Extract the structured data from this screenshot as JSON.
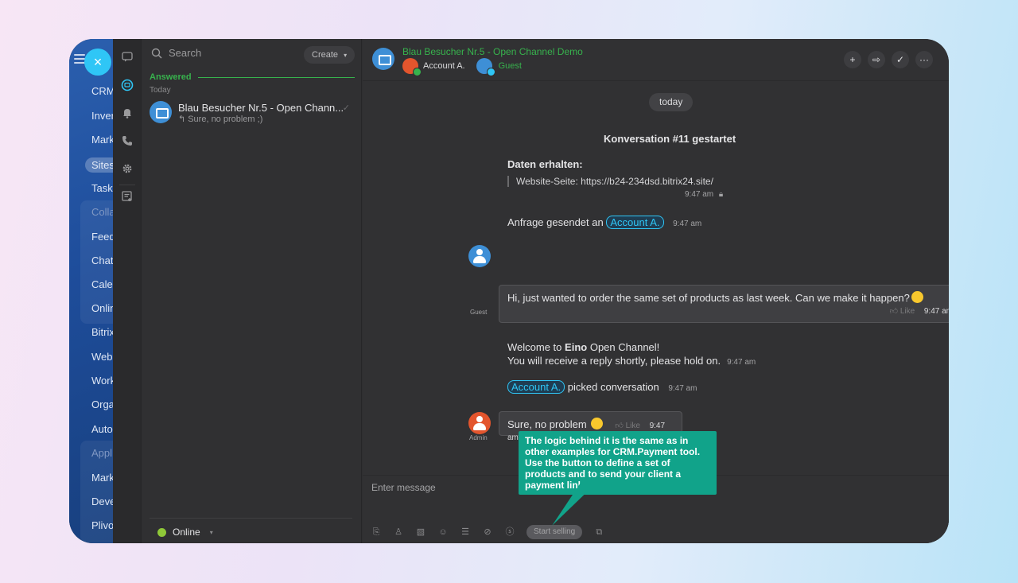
{
  "left_menu": {
    "items": [
      {
        "label": "CRM",
        "state": "normal"
      },
      {
        "label": "Inver",
        "state": "normal"
      },
      {
        "label": "Mark",
        "state": "normal"
      },
      {
        "label": "Sites",
        "state": "active"
      },
      {
        "label": "Task",
        "state": "normal"
      },
      {
        "label": "Colla",
        "state": "dim"
      },
      {
        "label": "Feed",
        "state": "normal"
      },
      {
        "label": "Chat",
        "state": "normal"
      },
      {
        "label": "Cale",
        "state": "normal"
      },
      {
        "label": "Onlin",
        "state": "normal"
      },
      {
        "label": "Bitrix",
        "state": "normal"
      },
      {
        "label": "Web",
        "state": "normal"
      },
      {
        "label": "Work",
        "state": "normal"
      },
      {
        "label": "Orga",
        "state": "normal"
      },
      {
        "label": "Auto",
        "state": "normal"
      },
      {
        "label": "Appl",
        "state": "dim"
      },
      {
        "label": "Mark",
        "state": "normal"
      },
      {
        "label": "Deve",
        "state": "normal"
      },
      {
        "label": "Plivo",
        "state": "normal"
      }
    ],
    "close_label": "×"
  },
  "rail": {
    "icons": [
      "chat-bubble-icon",
      "openlines-icon",
      "bell-icon",
      "phone-icon",
      "gear-icon",
      "tasks-icon"
    ]
  },
  "chat_list": {
    "search_placeholder": "Search",
    "create_label": "Create",
    "section_label": "Answered",
    "day_label": "Today",
    "item": {
      "title": "Blau Besucher Nr.5 - Open Chann...",
      "preview": "Sure, no problem ;)"
    },
    "status_label": "Online"
  },
  "header": {
    "title": "Blau Besucher Nr.5 - Open Channel Demo",
    "account_label": "Account A.",
    "guest_label": "Guest",
    "buttons": [
      "+",
      "⇨",
      "✓",
      "···"
    ]
  },
  "messages": {
    "day_pill": "today",
    "conversation_started": "Konversation #11 gestartet",
    "data_received_title": "Daten erhalten:",
    "website_line": "Website-Seite: https://b24-234dsd.bitrix24.site/",
    "website_time": "9:47 am",
    "request_sent_prefix": "Anfrage gesendet an",
    "request_mention": "Account A.",
    "request_time": "9:47 am",
    "guest_name": "Guest",
    "guest_message": "Hi, just wanted to order the same set of products as last week. Can we make it happen?",
    "guest_like": "Like",
    "guest_time": "9:47 am",
    "welcome_prefix": "Welcome to",
    "welcome_brand": "Eino",
    "welcome_suffix": "Open Channel!",
    "welcome_line2": "You will receive a reply shortly, please hold on.",
    "welcome_time": "9:47 am",
    "picked_mention": "Account A.",
    "picked_text": "picked conversation",
    "picked_time": "9:47 am",
    "admin_name": "Admin",
    "admin_message": "Sure, no problem",
    "admin_like": "Like",
    "admin_time": "9:47 am"
  },
  "composer": {
    "placeholder": "Enter message",
    "sell_button": "Start selling"
  },
  "tooltip": {
    "text": "The logic behind it is the same as in other examples for CRM.Payment tool. Use the button to define a set of products and to send your client a payment link"
  },
  "colors": {
    "accent_green": "#37b24d",
    "accent_blue": "#2fc6f6",
    "tooltip_bg": "#11a38a"
  }
}
